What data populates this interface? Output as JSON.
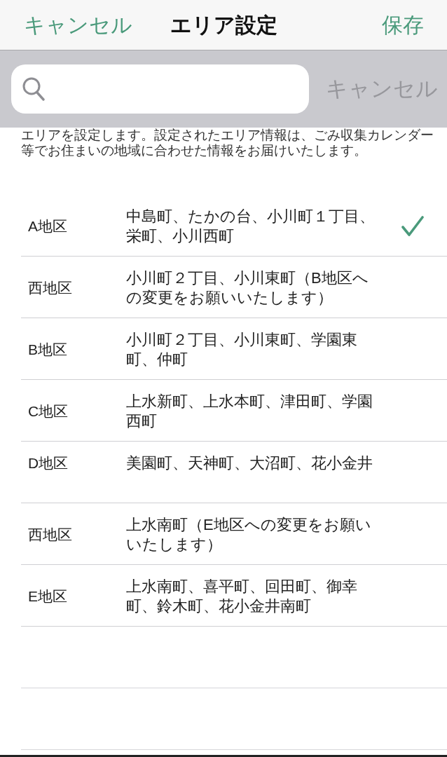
{
  "nav_bar": {
    "cancel_label": "キャンセル",
    "title": "エリア設定",
    "save_label": "保存"
  },
  "search_bar": {
    "cancel_label": "キャンセル"
  },
  "description": "エリアを設定します。設定されたエリア情報は、ごみ収集カレンダー等でお住まいの地域に合わせた情報をお届けいたします。",
  "areas": [
    {
      "name": "A地区",
      "towns": "中島町、たかの台、小川町１丁目、栄町、小川西町",
      "selected": true
    },
    {
      "name": "西地区",
      "towns": "小川町２丁目、小川東町（B地区への変更をお願いいたします）",
      "selected": false
    },
    {
      "name": "B地区",
      "towns": "小川町２丁目、小川東町、学園東町、仲町",
      "selected": false
    },
    {
      "name": "C地区",
      "towns": "上水新町、上水本町、津田町、学園西町",
      "selected": false
    },
    {
      "name": "D地区",
      "towns": "美園町、天神町、大沼町、花小金井",
      "selected": false
    },
    {
      "name": "西地区",
      "towns": "上水南町（E地区への変更をお願いいたします）",
      "selected": false
    },
    {
      "name": "E地区",
      "towns": "上水南町、喜平町、回田町、御幸町、鈴木町、花小金井南町",
      "selected": false
    }
  ]
}
